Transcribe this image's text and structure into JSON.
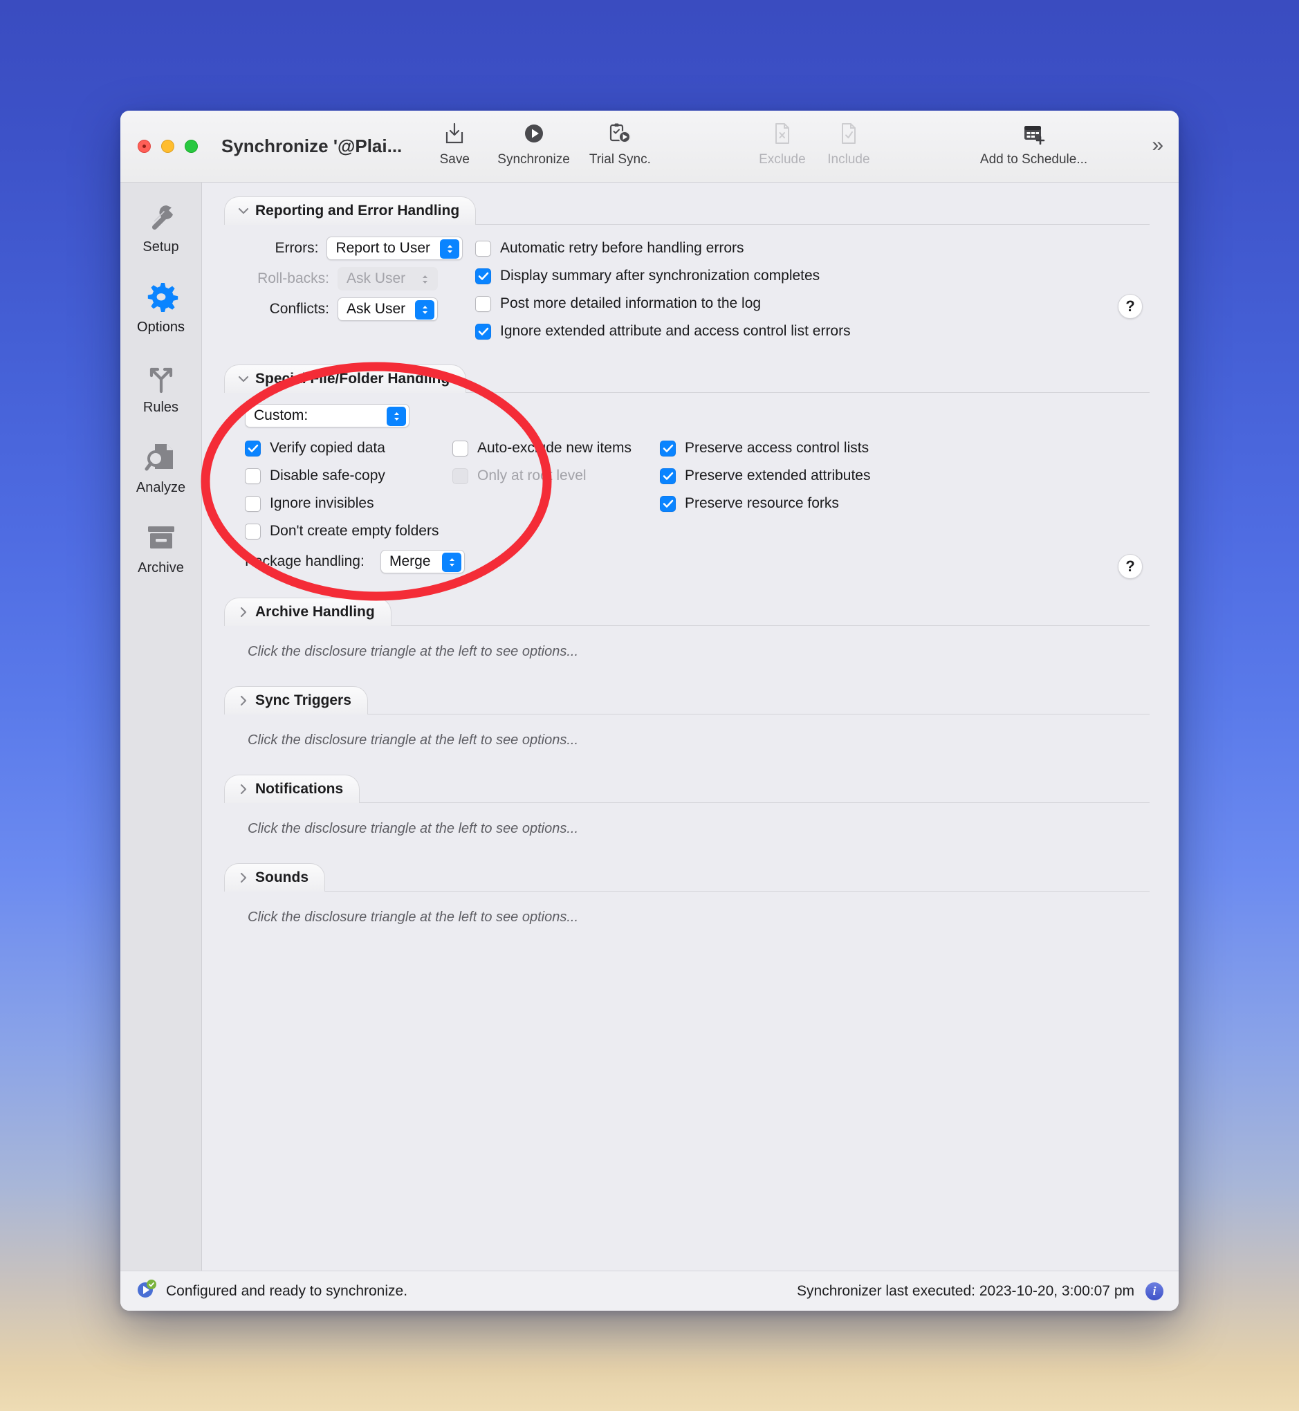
{
  "window": {
    "title": "Synchronize '@Plai...",
    "traffic_lights": [
      "close-button",
      "minimize-button",
      "zoom-button"
    ]
  },
  "toolbar": {
    "items": [
      {
        "label": "Save",
        "icon": "save-download-icon",
        "enabled": true
      },
      {
        "label": "Synchronize",
        "icon": "play-circle-icon",
        "enabled": true
      },
      {
        "label": "Trial Sync.",
        "icon": "clipboard-play-icon",
        "enabled": true
      },
      {
        "label": "Exclude",
        "icon": "document-x-icon",
        "enabled": false
      },
      {
        "label": "Include",
        "icon": "document-check-icon",
        "enabled": false
      },
      {
        "label": "Add to Schedule...",
        "icon": "calendar-plus-icon",
        "enabled": true
      }
    ],
    "overflow_label": "»"
  },
  "sidebar": {
    "items": [
      {
        "label": "Setup",
        "icon": "wrench-icon",
        "active": false
      },
      {
        "label": "Options",
        "icon": "gear-icon",
        "active": true
      },
      {
        "label": "Rules",
        "icon": "branch-arrows-icon",
        "active": false
      },
      {
        "label": "Analyze",
        "icon": "magnifier-document-icon",
        "active": false
      },
      {
        "label": "Archive",
        "icon": "archive-box-icon",
        "active": false
      }
    ]
  },
  "sections": {
    "reporting": {
      "title": "Reporting and Error Handling",
      "expanded": true,
      "fields": [
        {
          "label": "Errors:",
          "value": "Report to User",
          "enabled": true
        },
        {
          "label": "Roll-backs:",
          "value": "Ask User",
          "enabled": false
        },
        {
          "label": "Conflicts:",
          "value": "Ask User",
          "enabled": true
        }
      ],
      "checkboxes": [
        {
          "label": "Automatic retry before handling errors",
          "checked": false,
          "enabled": true
        },
        {
          "label": "Display summary after synchronization completes",
          "checked": true,
          "enabled": true
        },
        {
          "label": "Post more detailed information to the log",
          "checked": false,
          "enabled": true
        },
        {
          "label": "Ignore extended attribute and access control list errors",
          "checked": true,
          "enabled": true
        }
      ],
      "help_label": "?"
    },
    "special": {
      "title": "Special File/Folder Handling",
      "expanded": true,
      "preset": {
        "value": "Custom:"
      },
      "left_checkboxes": [
        {
          "label": "Verify copied data",
          "checked": true,
          "enabled": true
        },
        {
          "label": "Disable safe-copy",
          "checked": false,
          "enabled": true
        },
        {
          "label": "Ignore invisibles",
          "checked": false,
          "enabled": true
        },
        {
          "label": "Don't create empty folders",
          "checked": false,
          "enabled": true
        }
      ],
      "middle_checkboxes": [
        {
          "label": "Auto-exclude new items",
          "checked": false,
          "enabled": true
        },
        {
          "label": "Only at root level",
          "checked": false,
          "enabled": false
        }
      ],
      "right_checkboxes": [
        {
          "label": "Preserve access control lists",
          "checked": true,
          "enabled": true
        },
        {
          "label": "Preserve extended attributes",
          "checked": true,
          "enabled": true
        },
        {
          "label": "Preserve resource forks",
          "checked": true,
          "enabled": true
        }
      ],
      "package": {
        "label": "Package handling:",
        "value": "Merge"
      },
      "help_label": "?"
    },
    "collapsed": [
      {
        "title": "Archive Handling",
        "hint": "Click the disclosure triangle at the left to see options..."
      },
      {
        "title": "Sync Triggers",
        "hint": "Click the disclosure triangle at the left to see options..."
      },
      {
        "title": "Notifications",
        "hint": "Click the disclosure triangle at the left to see options..."
      },
      {
        "title": "Sounds",
        "hint": "Click the disclosure triangle at the left to see options..."
      }
    ]
  },
  "status": {
    "message": "Configured and ready to synchronize.",
    "last_executed": "Synchronizer last executed:  2023-10-20, 3:00:07 pm",
    "info_label": "i"
  },
  "annotation": {
    "shape": "red-ellipse-highlight",
    "color": "#f42c37"
  }
}
